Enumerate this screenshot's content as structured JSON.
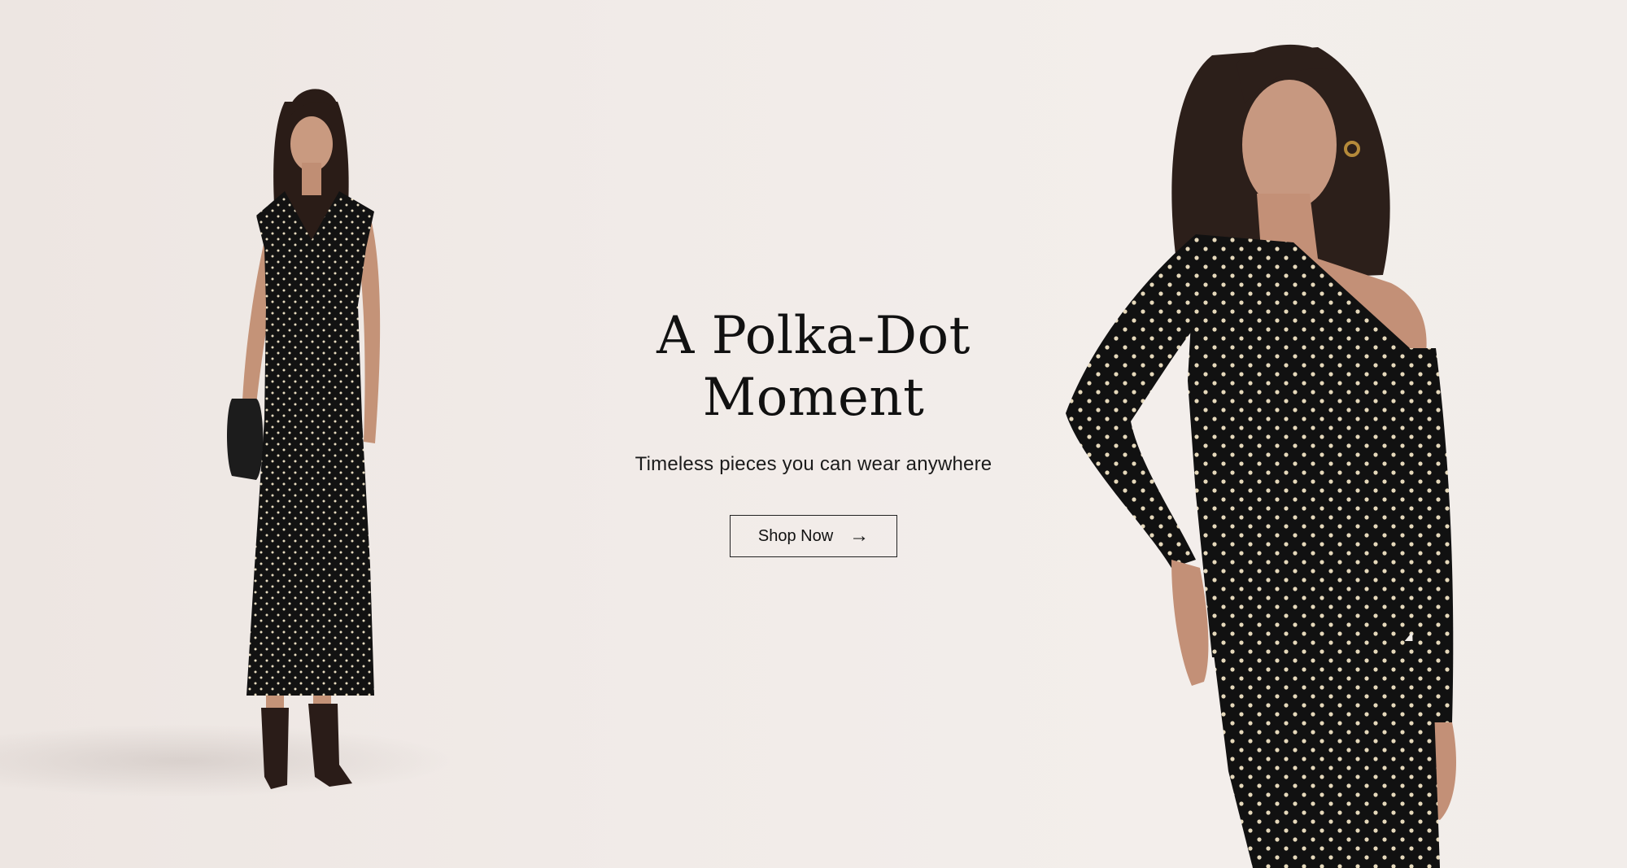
{
  "hero": {
    "headline_line1": "A Polka-Dot",
    "headline_line2": "Moment",
    "subheadline": "Timeless pieces you can wear anywhere",
    "cta_label": "Shop Now",
    "cta_icon": "arrow-right-icon",
    "cta_icon_glyph": "→"
  },
  "colors": {
    "background": "#f1ebe8",
    "text": "#111111",
    "garment": "#121212",
    "dots": "#e8dcc0"
  }
}
